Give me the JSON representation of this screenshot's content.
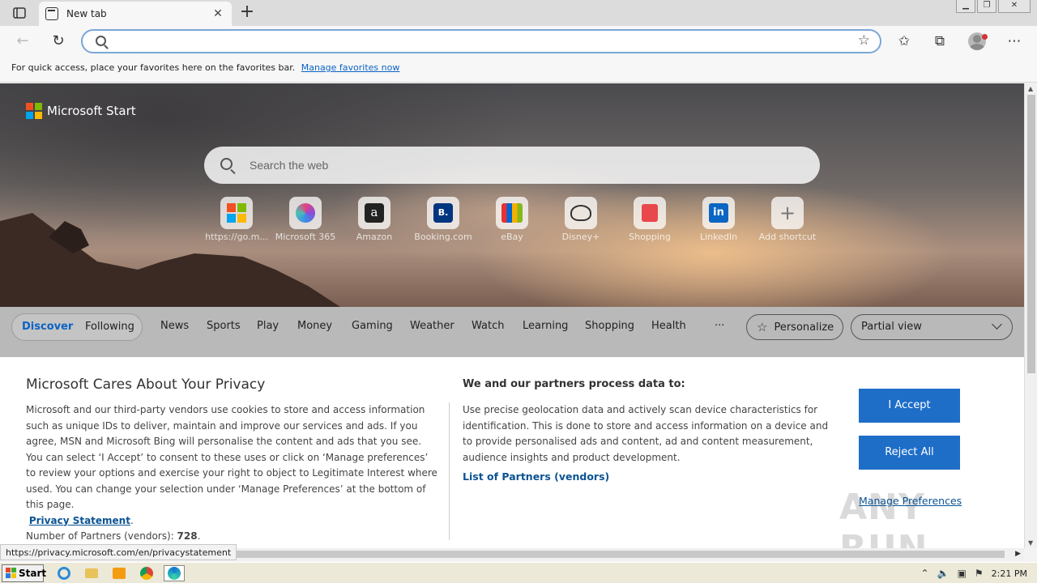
{
  "browser": {
    "tab_title": "New tab",
    "tab_close": "✕",
    "new_tab": "+",
    "address_placeholder": "",
    "address_value": "",
    "win_minimize": "▁",
    "win_restore": "❐",
    "win_close": "✕"
  },
  "favorites_bar": {
    "message": "For quick access, place your favorites here on the favorites bar.",
    "link": "Manage favorites now"
  },
  "start_page": {
    "brand": "Microsoft Start",
    "search_placeholder": "Search the web",
    "shortcuts": [
      {
        "label": "https://go.m...",
        "icon": "microsoft-logo-icon"
      },
      {
        "label": "Microsoft 365",
        "icon": "microsoft-365-icon"
      },
      {
        "label": "Amazon",
        "icon": "amazon-icon",
        "glyph": "a"
      },
      {
        "label": "Booking.com",
        "icon": "booking-icon",
        "glyph": "B."
      },
      {
        "label": "eBay",
        "icon": "ebay-icon"
      },
      {
        "label": "Disney+",
        "icon": "disney-icon"
      },
      {
        "label": "Shopping",
        "icon": "shopping-bag-icon"
      },
      {
        "label": "LinkedIn",
        "icon": "linkedin-icon",
        "glyph": "in"
      },
      {
        "label": "Add shortcut",
        "icon": "plus-icon",
        "glyph": "+"
      }
    ]
  },
  "feed_nav": {
    "pill": [
      "Discover",
      "Following"
    ],
    "categories": [
      "News",
      "Sports",
      "Play",
      "Money",
      "Gaming",
      "Weather",
      "Watch",
      "Learning",
      "Shopping",
      "Health"
    ],
    "more": "···",
    "personalize": "Personalize",
    "view": "Partial view"
  },
  "privacy": {
    "title": "Microsoft Cares About Your Privacy",
    "body": "Microsoft and our third-party vendors use cookies to store and access information such as unique IDs to deliver, maintain and improve our services and ads. If you agree, MSN and Microsoft Bing will personalise the content and ads that you see. You can select ‘I Accept’ to consent to these uses or click on ‘Manage preferences’ to review your options and exercise your right to object to Legitimate Interest where used.  You can change your selection under ‘Manage Preferences’ at the bottom of this page.",
    "privacy_link": "Privacy Statement",
    "partners_label": "Number of Partners (vendors):",
    "partners_count": "728",
    "right_title": "We and our partners process data to:",
    "right_body": "Use precise geolocation data and actively scan device characteristics for identification. This is done to store and access information on a device and to provide personalised ads and content, ad and content measurement, audience insights and product development.",
    "partners_link": "List of Partners (vendors)",
    "accept": "I Accept",
    "reject": "Reject All",
    "manage": "Manage Preferences"
  },
  "status_url": "https://privacy.microsoft.com/en/privacystatement",
  "watermark": "ANY RUN",
  "taskbar": {
    "start": "Start",
    "clock": "2:21 PM"
  }
}
